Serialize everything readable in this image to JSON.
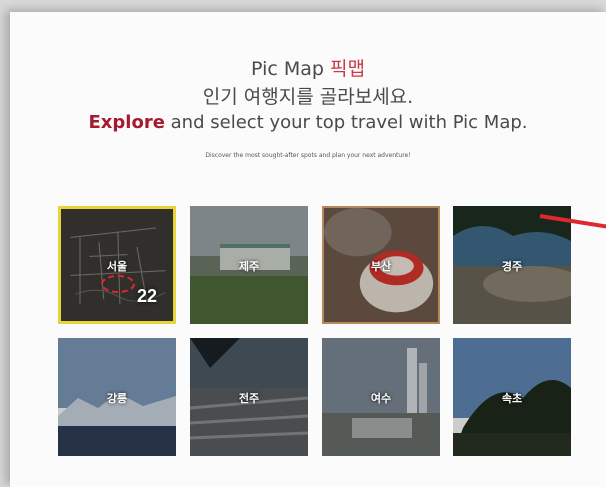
{
  "header": {
    "brand_en": "Pic Map",
    "brand_ko": "픽맵",
    "subtitle": "인기 여행지를 골라보세요.",
    "tagline_accent": "Explore",
    "tagline_rest": "and select your top travel with Pic Map.",
    "description": "Discover the most sought-after spots and plan your next adventure!"
  },
  "destinations": [
    {
      "label": "서울",
      "selected": true,
      "count": "22"
    },
    {
      "label": "제주"
    },
    {
      "label": "부산"
    },
    {
      "label": "경주"
    },
    {
      "label": "강릉"
    },
    {
      "label": "전주"
    },
    {
      "label": "여수"
    },
    {
      "label": "속초"
    }
  ],
  "colors": {
    "accent": "#c93a4a",
    "selected_border": "#e7d33a",
    "annotation_red": "#e0262e"
  }
}
